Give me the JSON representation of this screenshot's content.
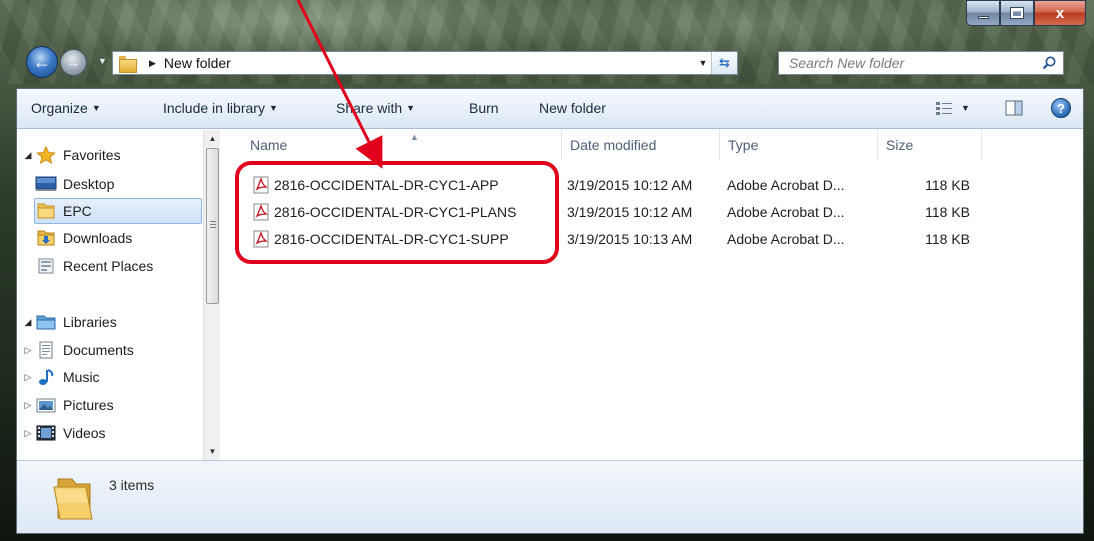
{
  "window": {
    "caption_buttons": {
      "minimize_icon": "minimize-icon",
      "maximize_icon": "maximize-icon",
      "close_icon": "close-icon",
      "close_glyph": "x"
    }
  },
  "address_bar": {
    "path": "New folder",
    "search_placeholder": "Search New folder"
  },
  "toolbar": {
    "organize": "Organize",
    "include_in_library": "Include in library",
    "share_with": "Share with",
    "burn": "Burn",
    "new_folder": "New folder"
  },
  "nav_pane": {
    "favorites_label": "Favorites",
    "favorites": [
      {
        "label": "Desktop",
        "icon": "desktop-icon"
      },
      {
        "label": "EPC",
        "icon": "folder-icon",
        "selected": true
      },
      {
        "label": "Downloads",
        "icon": "downloads-icon"
      },
      {
        "label": "Recent Places",
        "icon": "recent-places-icon"
      }
    ],
    "libraries_label": "Libraries",
    "libraries": [
      {
        "label": "Documents",
        "icon": "documents-icon"
      },
      {
        "label": "Music",
        "icon": "music-icon"
      },
      {
        "label": "Pictures",
        "icon": "pictures-icon"
      },
      {
        "label": "Videos",
        "icon": "videos-icon"
      }
    ]
  },
  "file_list": {
    "columns": [
      "Name",
      "Date modified",
      "Type",
      "Size"
    ],
    "rows": [
      {
        "name": "2816-OCCIDENTAL-DR-CYC1-APP",
        "date": "3/19/2015 10:12 AM",
        "type": "Adobe Acrobat D...",
        "size": "118 KB"
      },
      {
        "name": "2816-OCCIDENTAL-DR-CYC1-PLANS",
        "date": "3/19/2015 10:12 AM",
        "type": "Adobe Acrobat D...",
        "size": "118 KB"
      },
      {
        "name": "2816-OCCIDENTAL-DR-CYC1-SUPP",
        "date": "3/19/2015 10:13 AM",
        "type": "Adobe Acrobat D...",
        "size": "118 KB"
      }
    ]
  },
  "details": {
    "item_count": "3 items"
  },
  "colors": {
    "annotation": "#e0001b",
    "accent": "#3b78c5"
  }
}
